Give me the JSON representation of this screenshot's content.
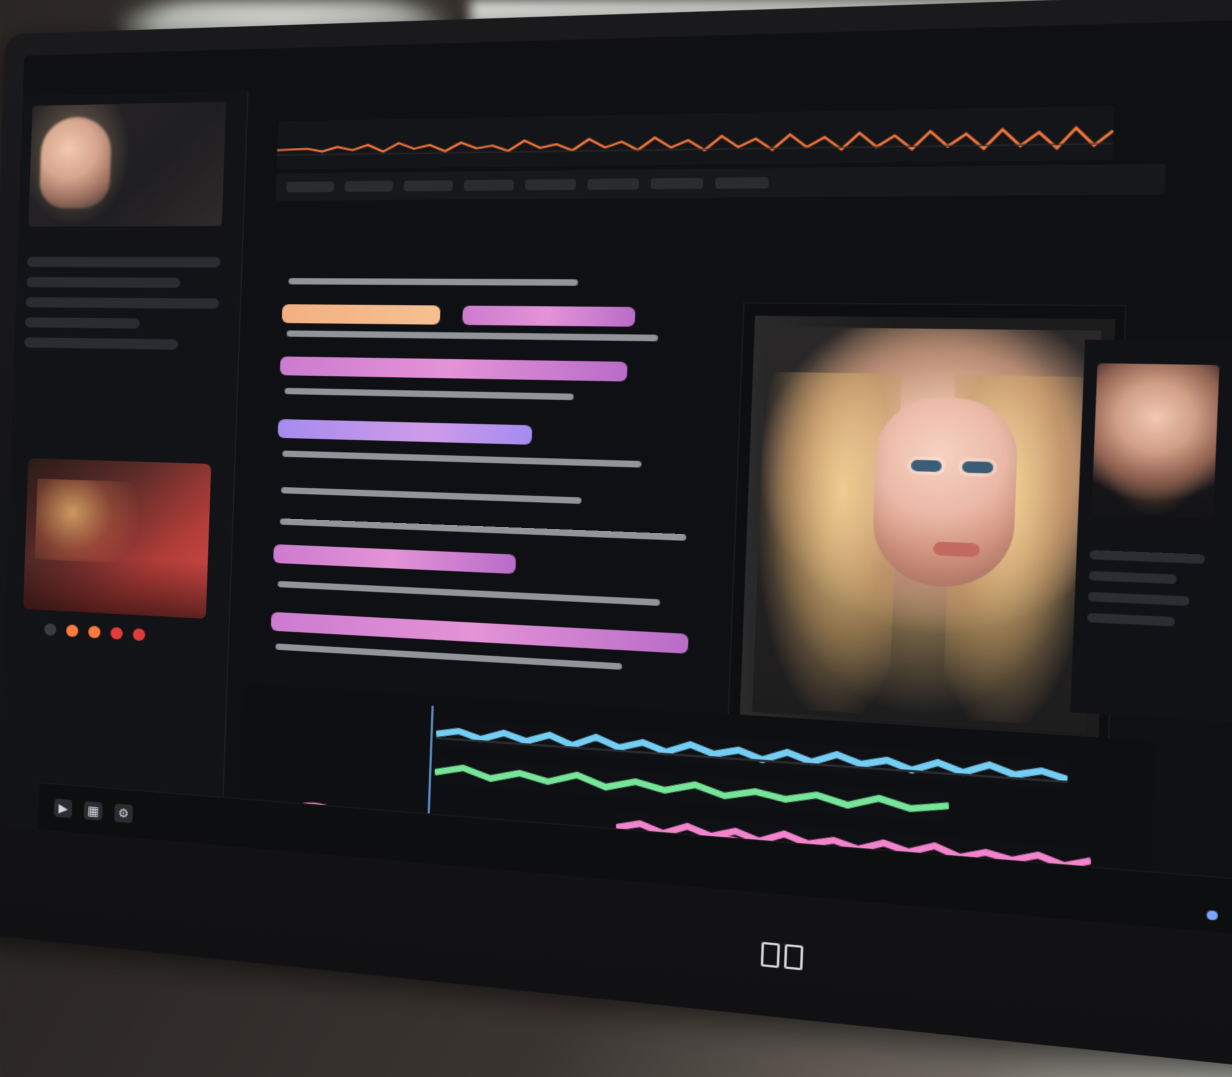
{
  "screen": {
    "topbar": {
      "title": "",
      "items": []
    },
    "left_panel": {
      "status_dots": [
        {
          "color": "#ff7a3c"
        },
        {
          "color": "#ff7a3c"
        },
        {
          "color": "#e23b3b"
        },
        {
          "color": "#e23b3b"
        }
      ]
    },
    "viewer": {
      "label": ""
    },
    "statusbar": {
      "icons": [
        {
          "name": "play-icon",
          "glyph": "▶"
        },
        {
          "name": "grid-icon",
          "glyph": "▦"
        },
        {
          "name": "settings-icon",
          "glyph": "⚙"
        }
      ]
    }
  },
  "monitor": {
    "logo_glyph": "⌂"
  },
  "colors": {
    "waveform_orange": "#ff7a3c",
    "clip_pink": "#e493d6",
    "clip_purple": "#a58bf0",
    "track_green": "#7cf0a0",
    "track_cyan": "#7ad9ff",
    "track_pink": "#ff8ad6",
    "power_led": "#7aa7ff"
  }
}
